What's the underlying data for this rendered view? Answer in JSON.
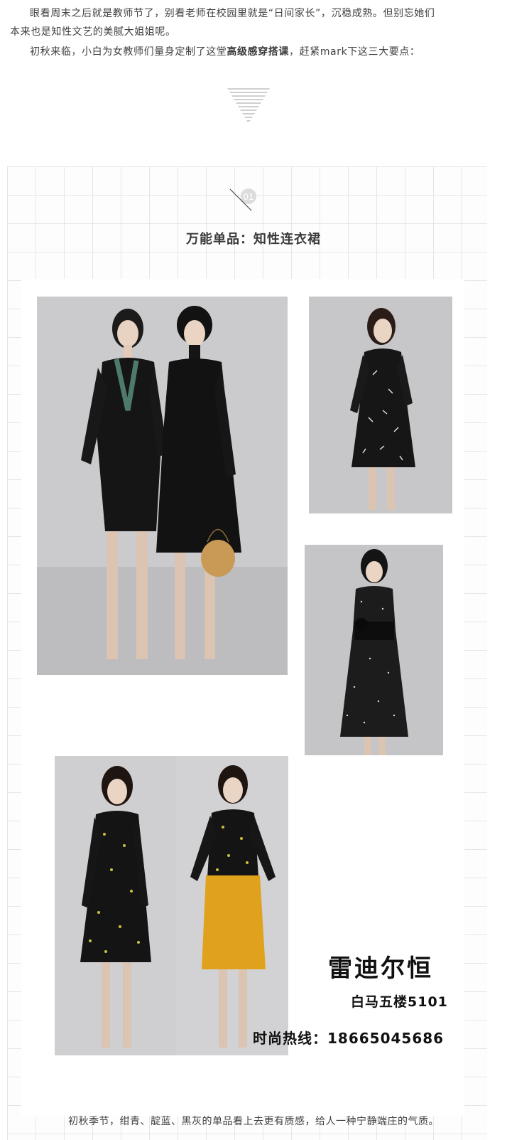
{
  "intro": {
    "line1": "眼看周末之后就是教师节了，别看老师在校园里就是“日间家长”，沉稳成熟。但别忘她们",
    "line2": "本来也是知性文艺的美腻大姐姐呢。",
    "line3_before": "初秋来临，小白为女教师们量身定制了这堂",
    "line3_bold": "高级感穿搭课",
    "line3_after": "，赶紧mark下这三大要点："
  },
  "section": {
    "number": "01",
    "title": "万能单品：知性连衣裙"
  },
  "brand": {
    "name": "雷迪尔恒",
    "address": "白马五楼5101",
    "hotline": "时尚热线：18665045686"
  },
  "caption": "初秋季节，绀青、靛蓝、黑灰的单品看上去更有质感，给人一种宁静端庄的气质。",
  "colors": {
    "photo_bg": "#c9c8cb",
    "dress_black": "#141414",
    "skirt_mustard": "#e0a21c",
    "print_yellow": "#c9c23a",
    "bag_tan": "#c99a55"
  }
}
